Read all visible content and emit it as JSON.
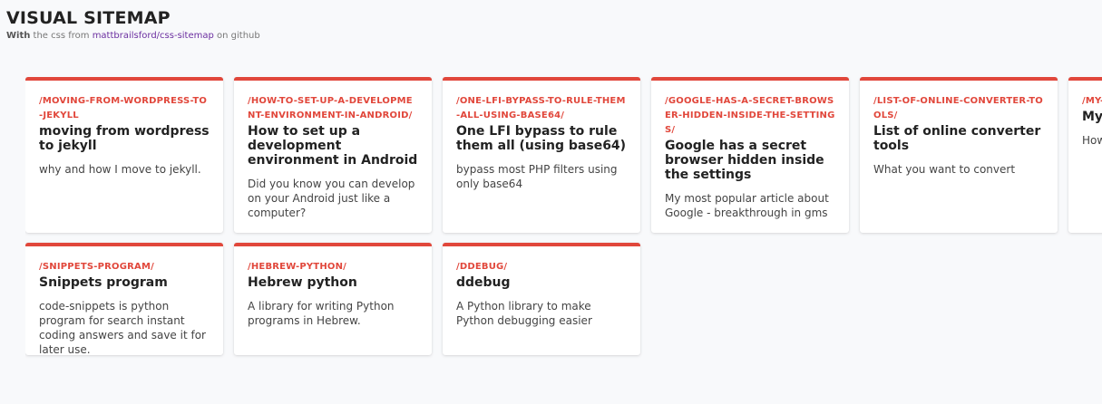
{
  "header": {
    "title": "VISUAL SITEMAP",
    "subtitle_strong": "With",
    "subtitle_mid": " the css from ",
    "subtitle_link": "mattbrailsford/css-sitemap",
    "subtitle_end": " on github"
  },
  "colors": {
    "accent": "#e1473b",
    "link": "#6b2fa0",
    "background": "#f8f9fb"
  },
  "cards": [
    {
      "url": "/moving-from-wordpress-to-jekyll",
      "title": "moving from wordpress to jekyll",
      "description": "why and how I move to jekyll."
    },
    {
      "url": "/how-to-set-up-a-development-environment-in-android/",
      "title": "How to set up a development environment in Android",
      "description": "Did you know you can develop on your Android just like a computer?"
    },
    {
      "url": "/one-lfi-bypass-to-rule-them-all-using-base64/",
      "title": "One LFI bypass to rule them all (using base64)",
      "description": "bypass most PHP filters using only base64"
    },
    {
      "url": "/google-has-a-secret-browser-hidden-inside-the-settings/",
      "title": "Google has a secret browser hidden inside the settings",
      "description": "My most popular article about Google - breakthrough in gms"
    },
    {
      "url": "/list-of-online-converter-tools/",
      "title": "List of online converter tools",
      "description": "What you want to convert"
    },
    {
      "url": "/my-",
      "title": "My",
      "description": "How Pow"
    },
    {
      "url": "/snippets-program/",
      "title": "Snippets program",
      "description": "code-snippets is python program for search instant coding answers and save it for later use."
    },
    {
      "url": "/hebrew-python/",
      "title": "Hebrew python",
      "description": "A library for writing Python programs in Hebrew."
    },
    {
      "url": "/ddebug/",
      "title": "ddebug",
      "description": "A Python library to make Python debugging easier"
    }
  ]
}
